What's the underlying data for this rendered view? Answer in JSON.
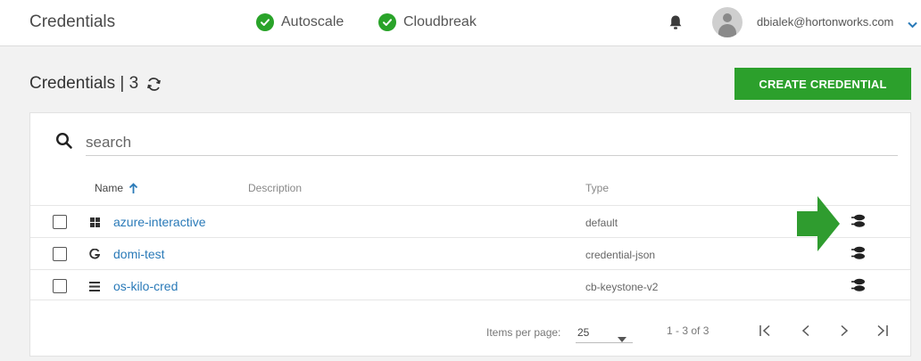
{
  "header": {
    "title": "Credentials",
    "statuses": [
      {
        "label": "Autoscale",
        "color": "#29a329",
        "icon": "check-circle-icon"
      },
      {
        "label": "Cloudbreak",
        "color": "#29a329",
        "icon": "check-circle-icon"
      }
    ],
    "user_email": "dbialek@hortonworks.com"
  },
  "page": {
    "title": "Credentials | 3",
    "create_button": "CREATE CREDENTIAL",
    "accent_color": "#2ca02c"
  },
  "search": {
    "placeholder": "search"
  },
  "table": {
    "columns": [
      "Name",
      "Description",
      "Type"
    ],
    "sort_column": "Name",
    "rows": [
      {
        "name": "azure-interactive",
        "description": "",
        "type": "default",
        "icon": "windows-icon"
      },
      {
        "name": "domi-test",
        "description": "",
        "type": "credential-json",
        "icon": "google-icon"
      },
      {
        "name": "os-kilo-cred",
        "description": "",
        "type": "cb-keystone-v2",
        "icon": "openstack-icon"
      }
    ]
  },
  "pagination": {
    "items_per_page_label": "Items per page:",
    "items_per_page": "25",
    "range": "1 - 3 of 3"
  },
  "annotation": {
    "arrow_color": "#2f9c2f",
    "icon": "arrow-right-icon"
  }
}
